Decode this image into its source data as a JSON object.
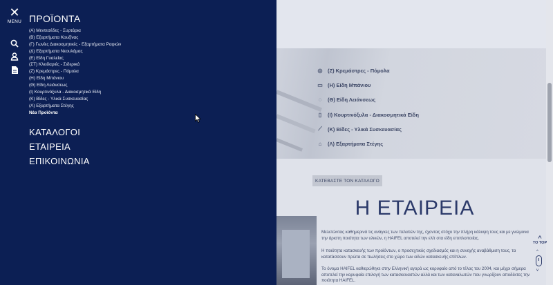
{
  "menu": {
    "close_label": "MENU",
    "title": "ΠΡΟΪΟΝΤΑ",
    "product_items": [
      "(Α) Μεντεσέδες - Συρτάρια",
      "(Β) Εξαρτήματα Κουζίνας",
      "(Γ) Γωνίες Διακοσμητικές - Εξαρτήματα Ραφιών",
      "(Δ) Εξαρτήματα Νεουλάμας",
      "(Ε) Είδη Γυαλείας",
      "(ΣΤ) Κλειδαριές - Σιδερικά",
      "(Ζ) Κρεμάστρες - Πόμολα",
      "(Η) Είδη Μπάνιου",
      "(Θ) Είδη Λειάνσεως",
      "(Ι) Κουρτινόξυλα - Διακοσμητικά Είδη",
      "(Κ) Βίδες - Υλικά Συσκευασίας",
      "(Λ) Εξαρτήματα Στέγης"
    ],
    "new_products": "Νέα Προϊόντα",
    "main_items": [
      "ΚΑΤΑΛΟΓΟΙ",
      "ΕΤΑΙΡΕΙΑ",
      "ΕΠΙΚΟΙΝΩΝΙΑ"
    ],
    "side_icons": [
      "search-icon",
      "user-icon",
      "document-icon"
    ]
  },
  "page": {
    "category_list": [
      {
        "label": "(Ζ) Κρεμάστρες - Πόμολα",
        "icon": "knob-icon"
      },
      {
        "label": "(Η) Είδη Μπάνιου",
        "icon": "bath-icon"
      },
      {
        "label": "(Θ) Είδη Λειάνσεως",
        "icon": "sanding-icon"
      },
      {
        "label": "(Ι) Κουρτινόξυλα - Διακοσμητικά Είδη",
        "icon": "bookmark-icon"
      },
      {
        "label": "(Κ) Βίδες - Υλικά Συσκευασίας",
        "icon": "screw-icon"
      },
      {
        "label": "(Λ) Εξαρτήματα Στέγης",
        "icon": "roof-icon"
      }
    ],
    "download_button": "ΚΑΤΕΒΑΣΤΕ ΤΟΝ ΚΑΤΑΛΟΓΟ",
    "company_title": "Η ΕΤΑΙΡΕΙΑ",
    "paragraphs": [
      "Μελετώντας καθημερινά τις ανάγκες των πελατών της, έχοντας στόχο την πλήρη κάλυψη τους και με γνώμονα την άριστη ποιότητα των υλικών, η HAIFEL αποτελεί την ελίτ στα είδη επιπλοποιίας.",
      "Η ποιότητα κατασκευής των προϊόντων, ο προσεχτικός σχεδιασμός και η συνεχής αναβάθμιση τους, τα κατατάσσουν πρώτα σε πωλήσεις στο χώρο των ειδών κατασκευής επίπλων.",
      "Το όνομα HAIFEL καθιερώθηκε στην Ελληνική αγορά ως κορυφαίο από το τέλος του 2004, και μέχρι σήμερα αποτελεί την κορυφαία επιλογή των κατασκευαστών αλλά και των καταναλωτών που γνωρίζουν αποδέκτες την ποιότητα HAIFEL."
    ],
    "to_top": "TO TOP"
  },
  "colors": {
    "menu_bg": "#0c1f54",
    "accent": "#2c3a6a"
  }
}
